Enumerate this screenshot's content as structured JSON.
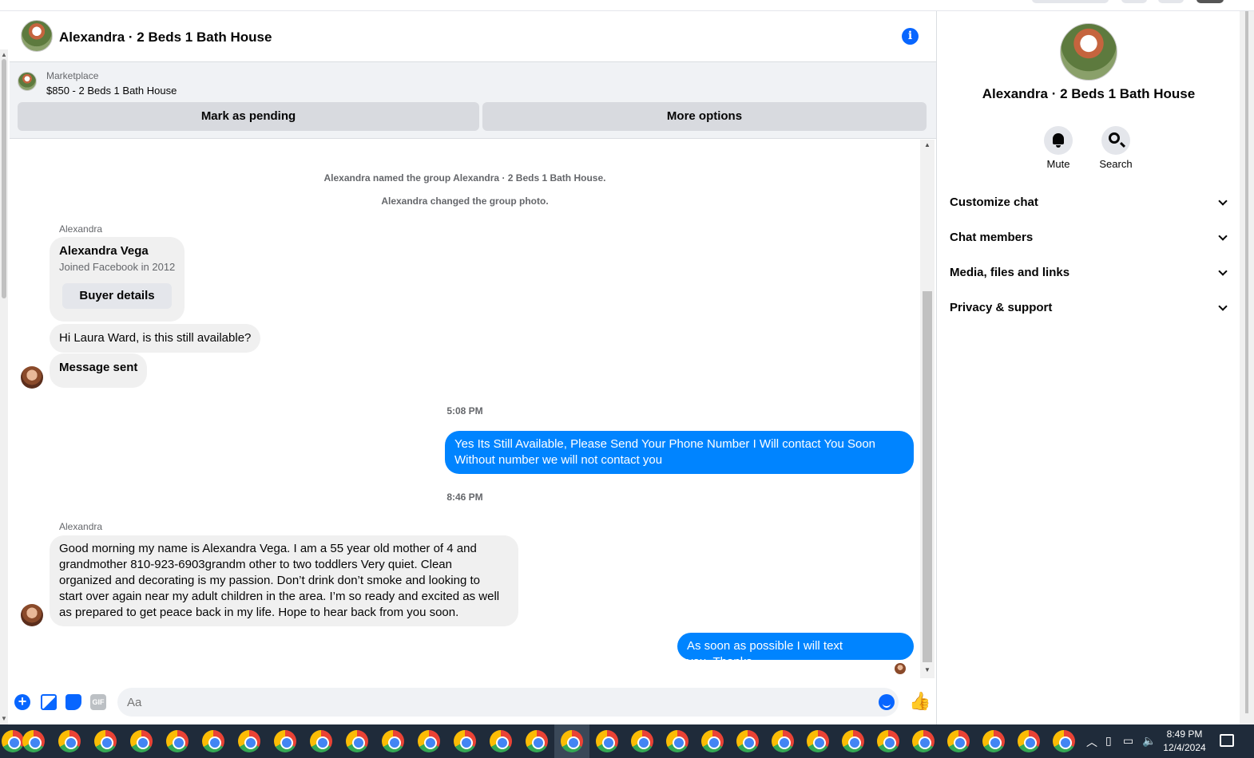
{
  "header": {
    "title": "Alexandra · 2 Beds 1 Bath House"
  },
  "marketplace": {
    "label": "Marketplace",
    "item": "$850 - 2 Beds 1 Bath House",
    "mark_pending": "Mark as pending",
    "more_options": "More options"
  },
  "chat": {
    "system": [
      "Alexandra named the group Alexandra · 2 Beds 1 Bath House.",
      "Alexandra changed the group photo."
    ],
    "sender": "Alexandra",
    "profile": {
      "name": "Alexandra Vega",
      "joined": "Joined Facebook in 2012",
      "buyer_details": "Buyer details"
    },
    "msg1": "Hi Laura Ward, is this still available?",
    "msg2": "Message sent",
    "time1": "5:08 PM",
    "out1_line1": "Yes Its Still Available, Please Send Your Phone Number I Will contact  You Soon",
    "out1_line2": "Without number we will not contact you",
    "time2": "8:46 PM",
    "sender2": "Alexandra",
    "long_msg": [
      "Good morning my name is Alexandra Vega. I am a 55 year old mother of 4 and",
      "grandmother 810-923-6903grandm other to two toddlers Very quiet. Clean",
      "organized and decorating is my passion. Don’t drink don’t smoke and looking to",
      "start over again near my adult children in the area.  I’m so ready and excited as well",
      "as prepared to get peace back in my life. Hope to hear back from you soon."
    ],
    "out2": "As soon as possible I will text you..Thanks"
  },
  "composer": {
    "placeholder": "Aa",
    "gif_label": "GIF"
  },
  "right_panel": {
    "title": "Alexandra · 2 Beds 1 Bath House",
    "mute": "Mute",
    "search": "Search",
    "sections": [
      "Customize chat",
      "Chat members",
      "Media, files and links",
      "Privacy & support"
    ]
  },
  "taskbar": {
    "time": "8:49 PM",
    "date": "12/4/2024"
  },
  "colors": {
    "accent": "#0866ff",
    "outgoing_bubble": "#0084ff",
    "incoming_bubble": "#f0f0f0"
  }
}
